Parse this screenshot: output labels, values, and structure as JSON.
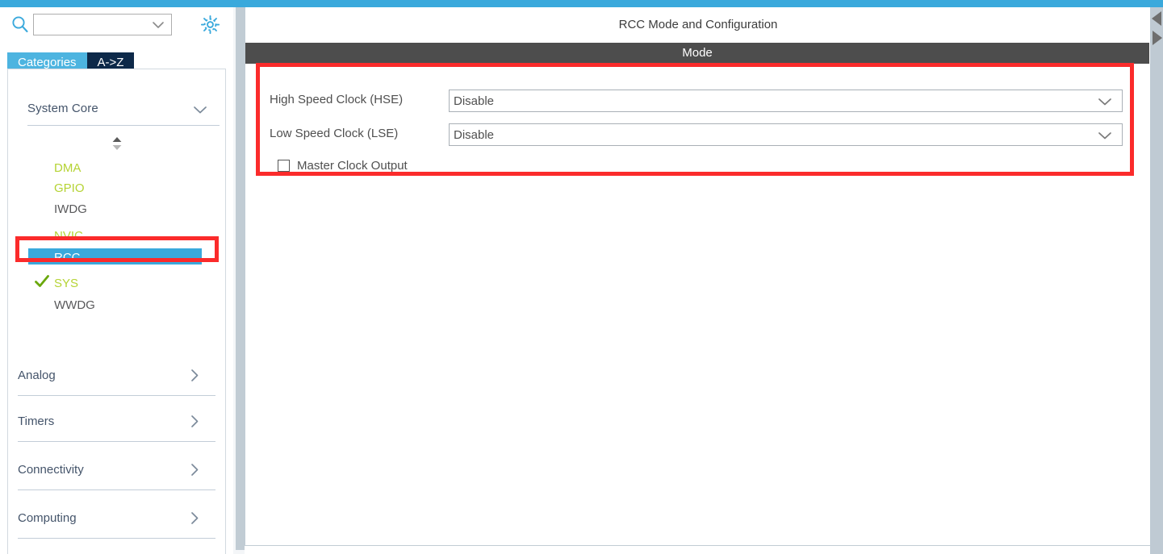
{
  "window": {
    "accent_color": "#3aa9dc",
    "splitter_color": "#c1ccd4"
  },
  "sidebar": {
    "search": {
      "icon": "search-icon",
      "value": "",
      "placeholder": ""
    },
    "settings_icon": "gear-icon",
    "tabs": [
      {
        "label": "Categories",
        "selected": true,
        "color": "#4db4e0"
      },
      {
        "label": "A->Z",
        "selected": false,
        "color": "#0d2949"
      }
    ],
    "expanded_group": {
      "label": "System Core",
      "chevron": "chevron-down-icon",
      "scroll_spinner": "scroll-up-down-icon",
      "items": [
        {
          "label": "DMA",
          "state": "configured",
          "color": "#b5d334",
          "checked": false,
          "selected": false
        },
        {
          "label": "GPIO",
          "state": "configured",
          "color": "#b5d334",
          "checked": false,
          "selected": false
        },
        {
          "label": "IWDG",
          "state": "unconfigured",
          "color": "#59595b",
          "checked": false,
          "selected": false
        },
        {
          "label": "NVIC",
          "state": "configured",
          "color": "#b5d334",
          "checked": false,
          "selected": false
        },
        {
          "label": "RCC",
          "state": "selected",
          "color": "#ffffff",
          "checked": false,
          "selected": true
        },
        {
          "label": "SYS",
          "state": "configured",
          "color": "#b5d334",
          "checked": true,
          "selected": false
        },
        {
          "label": "WWDG",
          "state": "unconfigured",
          "color": "#59595b",
          "checked": false,
          "selected": false
        }
      ]
    },
    "collapsed_groups": [
      {
        "label": "Analog",
        "chevron": "chevron-right-icon"
      },
      {
        "label": "Timers",
        "chevron": "chevron-right-icon"
      },
      {
        "label": "Connectivity",
        "chevron": "chevron-right-icon"
      },
      {
        "label": "Computing",
        "chevron": "chevron-right-icon"
      }
    ]
  },
  "main": {
    "title": "RCC Mode and Configuration",
    "section_header": "Mode",
    "fields": [
      {
        "label": "High Speed Clock (HSE)",
        "value": "Disable",
        "control": "dropdown"
      },
      {
        "label": "Low Speed Clock (LSE)",
        "value": "Disable",
        "control": "dropdown"
      }
    ],
    "checkbox": {
      "label": "Master Clock Output",
      "checked": false
    }
  },
  "annotations": {
    "color": "#fb2b2b",
    "boxes": [
      {
        "name": "rcc-sidebar-highlight"
      },
      {
        "name": "mode-panel-highlight"
      }
    ]
  },
  "edge": {
    "collapse_left_icon": "arrow-left-icon",
    "collapse_right_icon": "arrow-right-icon"
  }
}
